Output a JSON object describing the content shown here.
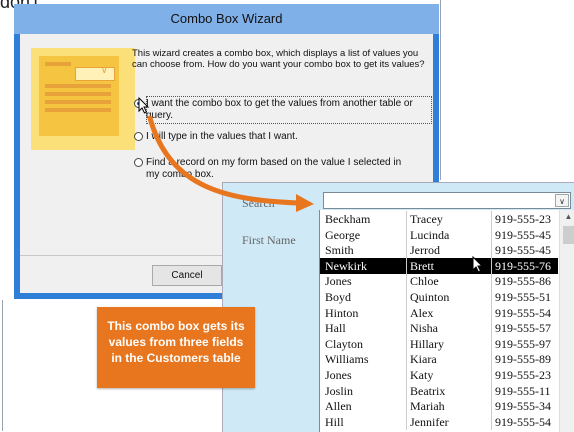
{
  "page_fragment": "don't",
  "wizard": {
    "title": "Combo Box Wizard",
    "intro": "This wizard creates a combo box, which displays a list of values you can choose from.  How do you want your combo box to get its values?",
    "options": [
      {
        "label": "I want the combo box to get the values from another table or query.",
        "selected": true
      },
      {
        "label": "I will type in the values that I want.",
        "selected": false
      },
      {
        "label": "Find a record on my form based on the value I selected in my combo box.",
        "selected": false
      }
    ],
    "cancel_label": "Cancel"
  },
  "form": {
    "search_label": "Search",
    "first_name_label": "First Name",
    "search_value": "",
    "rows": [
      {
        "last": "Beckham",
        "first": "Tracey",
        "phone": "919-555-23"
      },
      {
        "last": "George",
        "first": "Lucinda",
        "phone": "919-555-45"
      },
      {
        "last": "Smith",
        "first": "Jerrod",
        "phone": "919-555-45"
      },
      {
        "last": "Newkirk",
        "first": "Brett",
        "phone": "919-555-76",
        "selected": true
      },
      {
        "last": "Jones",
        "first": "Chloe",
        "phone": "919-555-86"
      },
      {
        "last": "Boyd",
        "first": "Quinton",
        "phone": "919-555-51"
      },
      {
        "last": "Hinton",
        "first": "Alex",
        "phone": "919-555-54"
      },
      {
        "last": "Hall",
        "first": "Nisha",
        "phone": "919-555-57"
      },
      {
        "last": "Clayton",
        "first": "Hillary",
        "phone": "919-555-97"
      },
      {
        "last": "Williams",
        "first": "Kiara",
        "phone": "919-555-89"
      },
      {
        "last": "Jones",
        "first": "Katy",
        "phone": "919-555-23"
      },
      {
        "last": "Joslin",
        "first": "Beatrix",
        "phone": "919-555-11"
      },
      {
        "last": "Allen",
        "first": "Mariah",
        "phone": "919-555-34"
      },
      {
        "last": "Hill",
        "first": "Jennifer",
        "phone": "919-555-54"
      }
    ]
  },
  "callout": {
    "text": "This combo box gets its values from three fields in the Customers table",
    "color": "#e8761f"
  },
  "colors": {
    "window_frame": "#2f7ed8",
    "form_background": "#cfe9f7",
    "accent_arrow": "#e8761f"
  }
}
